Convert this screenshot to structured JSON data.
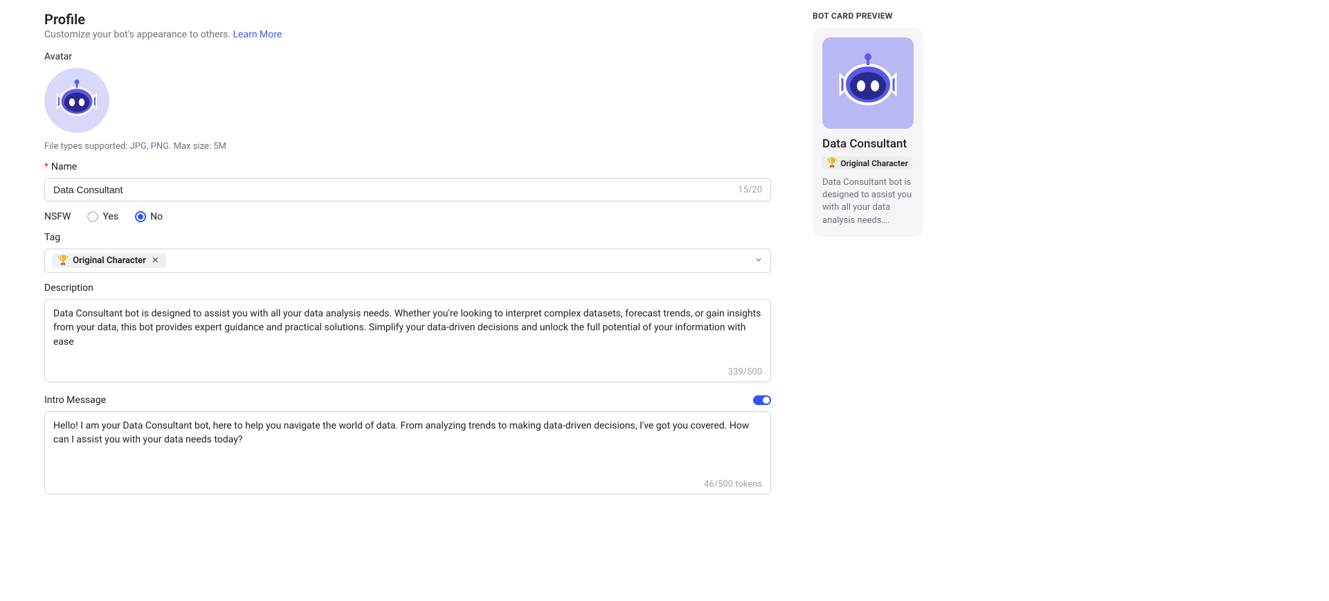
{
  "profile": {
    "title": "Profile",
    "subtitle": "Customize your bot's appearance to others. ",
    "learn_more": "Learn More"
  },
  "avatar": {
    "label": "Avatar",
    "hint": "File types supported: JPG, PNG. Max size: 5M"
  },
  "name": {
    "label": "Name",
    "value": "Data Consultant",
    "counter": "15/20"
  },
  "nsfw": {
    "label": "NSFW",
    "yes": "Yes",
    "no": "No",
    "selected": "no"
  },
  "tag": {
    "label": "Tag",
    "chip_emoji": "🏆",
    "chip_label": "Original Character"
  },
  "description": {
    "label": "Description",
    "value": "Data Consultant bot is designed to assist you with all your data analysis needs. Whether you're looking to interpret complex datasets, forecast trends, or gain insights from your data, this bot provides expert guidance and practical solutions. Simplify your data-driven decisions and unlock the full potential of your information with ease",
    "counter": "339/500"
  },
  "intro": {
    "label": "Intro Message",
    "value": "Hello! I am your Data Consultant bot, here to help you navigate the world of data. From analyzing trends to making data-driven decisions, I've got you covered. How can I assist you with your data needs today?",
    "counter": "46/500 tokens"
  },
  "preview": {
    "title": "BOT CARD PREVIEW",
    "name": "Data Consultant",
    "tag_emoji": "🏆",
    "tag_label": "Original Character",
    "desc": "Data Consultant bot is designed to assist you with all your data analysis needs…."
  }
}
